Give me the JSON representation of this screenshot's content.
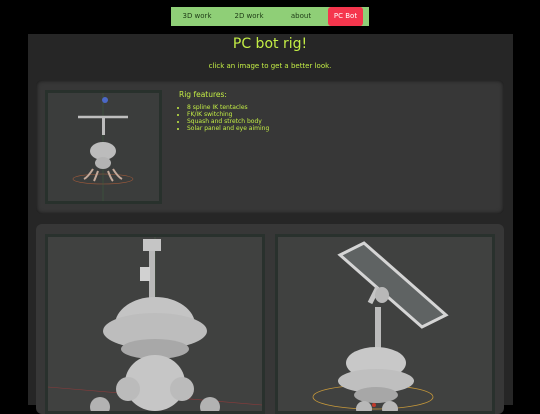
{
  "nav": {
    "links": [
      {
        "label": "3D work"
      },
      {
        "label": "2D work"
      },
      {
        "label": "about"
      },
      {
        "label": "PC Bot"
      }
    ]
  },
  "header": {
    "title": "PC bot rig!",
    "subtitle": "click an image to get a better look."
  },
  "features": {
    "heading": "Rig features:",
    "items": [
      "8 spline IK tentacles",
      "FK/IK switching",
      "Squash and stretch body",
      "Solar panel and eye aiming"
    ]
  },
  "colors": {
    "nav_bg": "#8fcf77",
    "active_tab": "#f5364d",
    "accent_text": "#c3ed45"
  }
}
